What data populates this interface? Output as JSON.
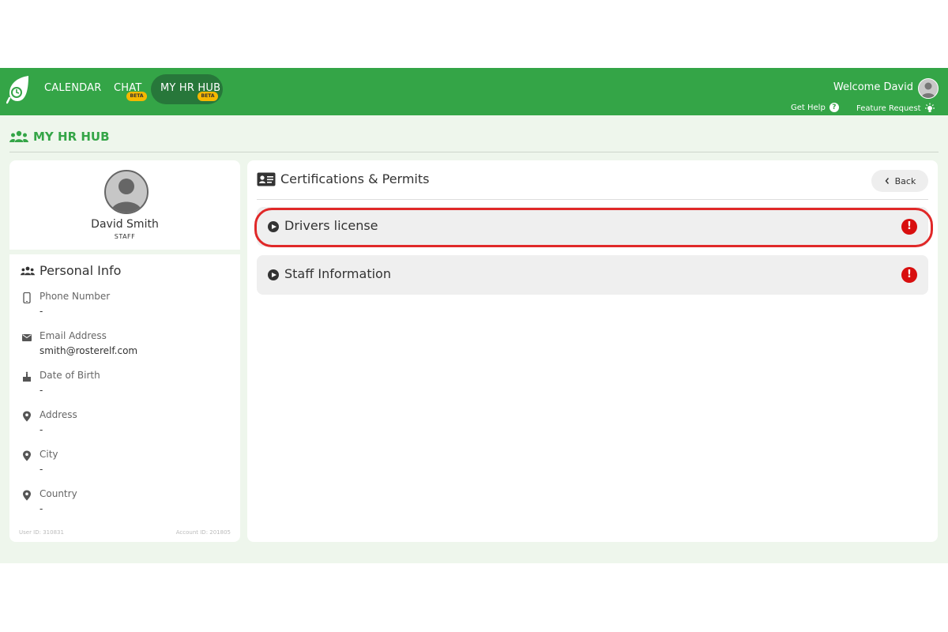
{
  "nav": {
    "calendar": "CALENDAR",
    "chat": "CHAT",
    "chat_badge": "BETA",
    "hr_hub": "MY HR HUB",
    "hr_hub_badge": "BETA",
    "welcome": "Welcome David",
    "help": "Get Help",
    "feature": "Feature Request"
  },
  "page": {
    "title": "MY HR HUB"
  },
  "profile": {
    "name": "David Smith",
    "role": "STAFF",
    "section_title": "Personal Info",
    "fields": [
      {
        "label": "Phone Number",
        "value": "-",
        "icon": "phone-icon"
      },
      {
        "label": "Email Address",
        "value": "smith@rosterelf.com",
        "icon": "mail-icon"
      },
      {
        "label": "Date of Birth",
        "value": "-",
        "icon": "cake-icon"
      },
      {
        "label": "Address",
        "value": "-",
        "icon": "location-pin-icon"
      },
      {
        "label": "City",
        "value": "-",
        "icon": "location-pin-icon"
      },
      {
        "label": "Country",
        "value": "-",
        "icon": "location-pin-icon"
      }
    ],
    "user_id": "User ID: 310831",
    "account_id": "Account ID: 201805"
  },
  "certifications": {
    "title": "Certifications & Permits",
    "back_label": "Back",
    "items": [
      {
        "label": "Drivers license",
        "alert": "!"
      },
      {
        "label": "Staff Information",
        "alert": "!"
      }
    ]
  },
  "colors": {
    "brand": "#34a547",
    "nav_active": "#27773a",
    "badge": "#f5b800",
    "alert": "#d80f0f",
    "highlight": "#e02828"
  }
}
